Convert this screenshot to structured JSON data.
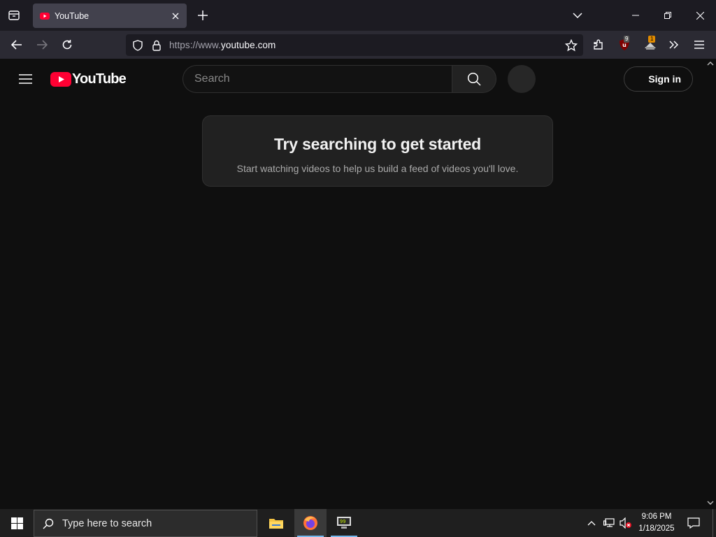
{
  "browser": {
    "tab": {
      "title": "YouTube"
    },
    "url": {
      "prefix": "https://www.",
      "domain": "youtube.com"
    },
    "extensions": {
      "ublock_badge": "9",
      "extension2_badge": "1"
    }
  },
  "youtube": {
    "logo_text": "YouTube",
    "search": {
      "placeholder": "Search"
    },
    "signin_label": "Sign in",
    "prompt": {
      "title": "Try searching to get started",
      "subtitle": "Start watching videos to help us build a feed of videos you'll love."
    }
  },
  "taskbar": {
    "search_placeholder": "Type here to search",
    "clock": {
      "time": "9:06 PM",
      "date": "1/18/2025"
    }
  },
  "colors": {
    "youtube_red": "#ff0033",
    "page_bg": "#0f0f0f",
    "chrome_tabbar": "#1c1b22",
    "chrome_navbar": "#2b2a33"
  }
}
